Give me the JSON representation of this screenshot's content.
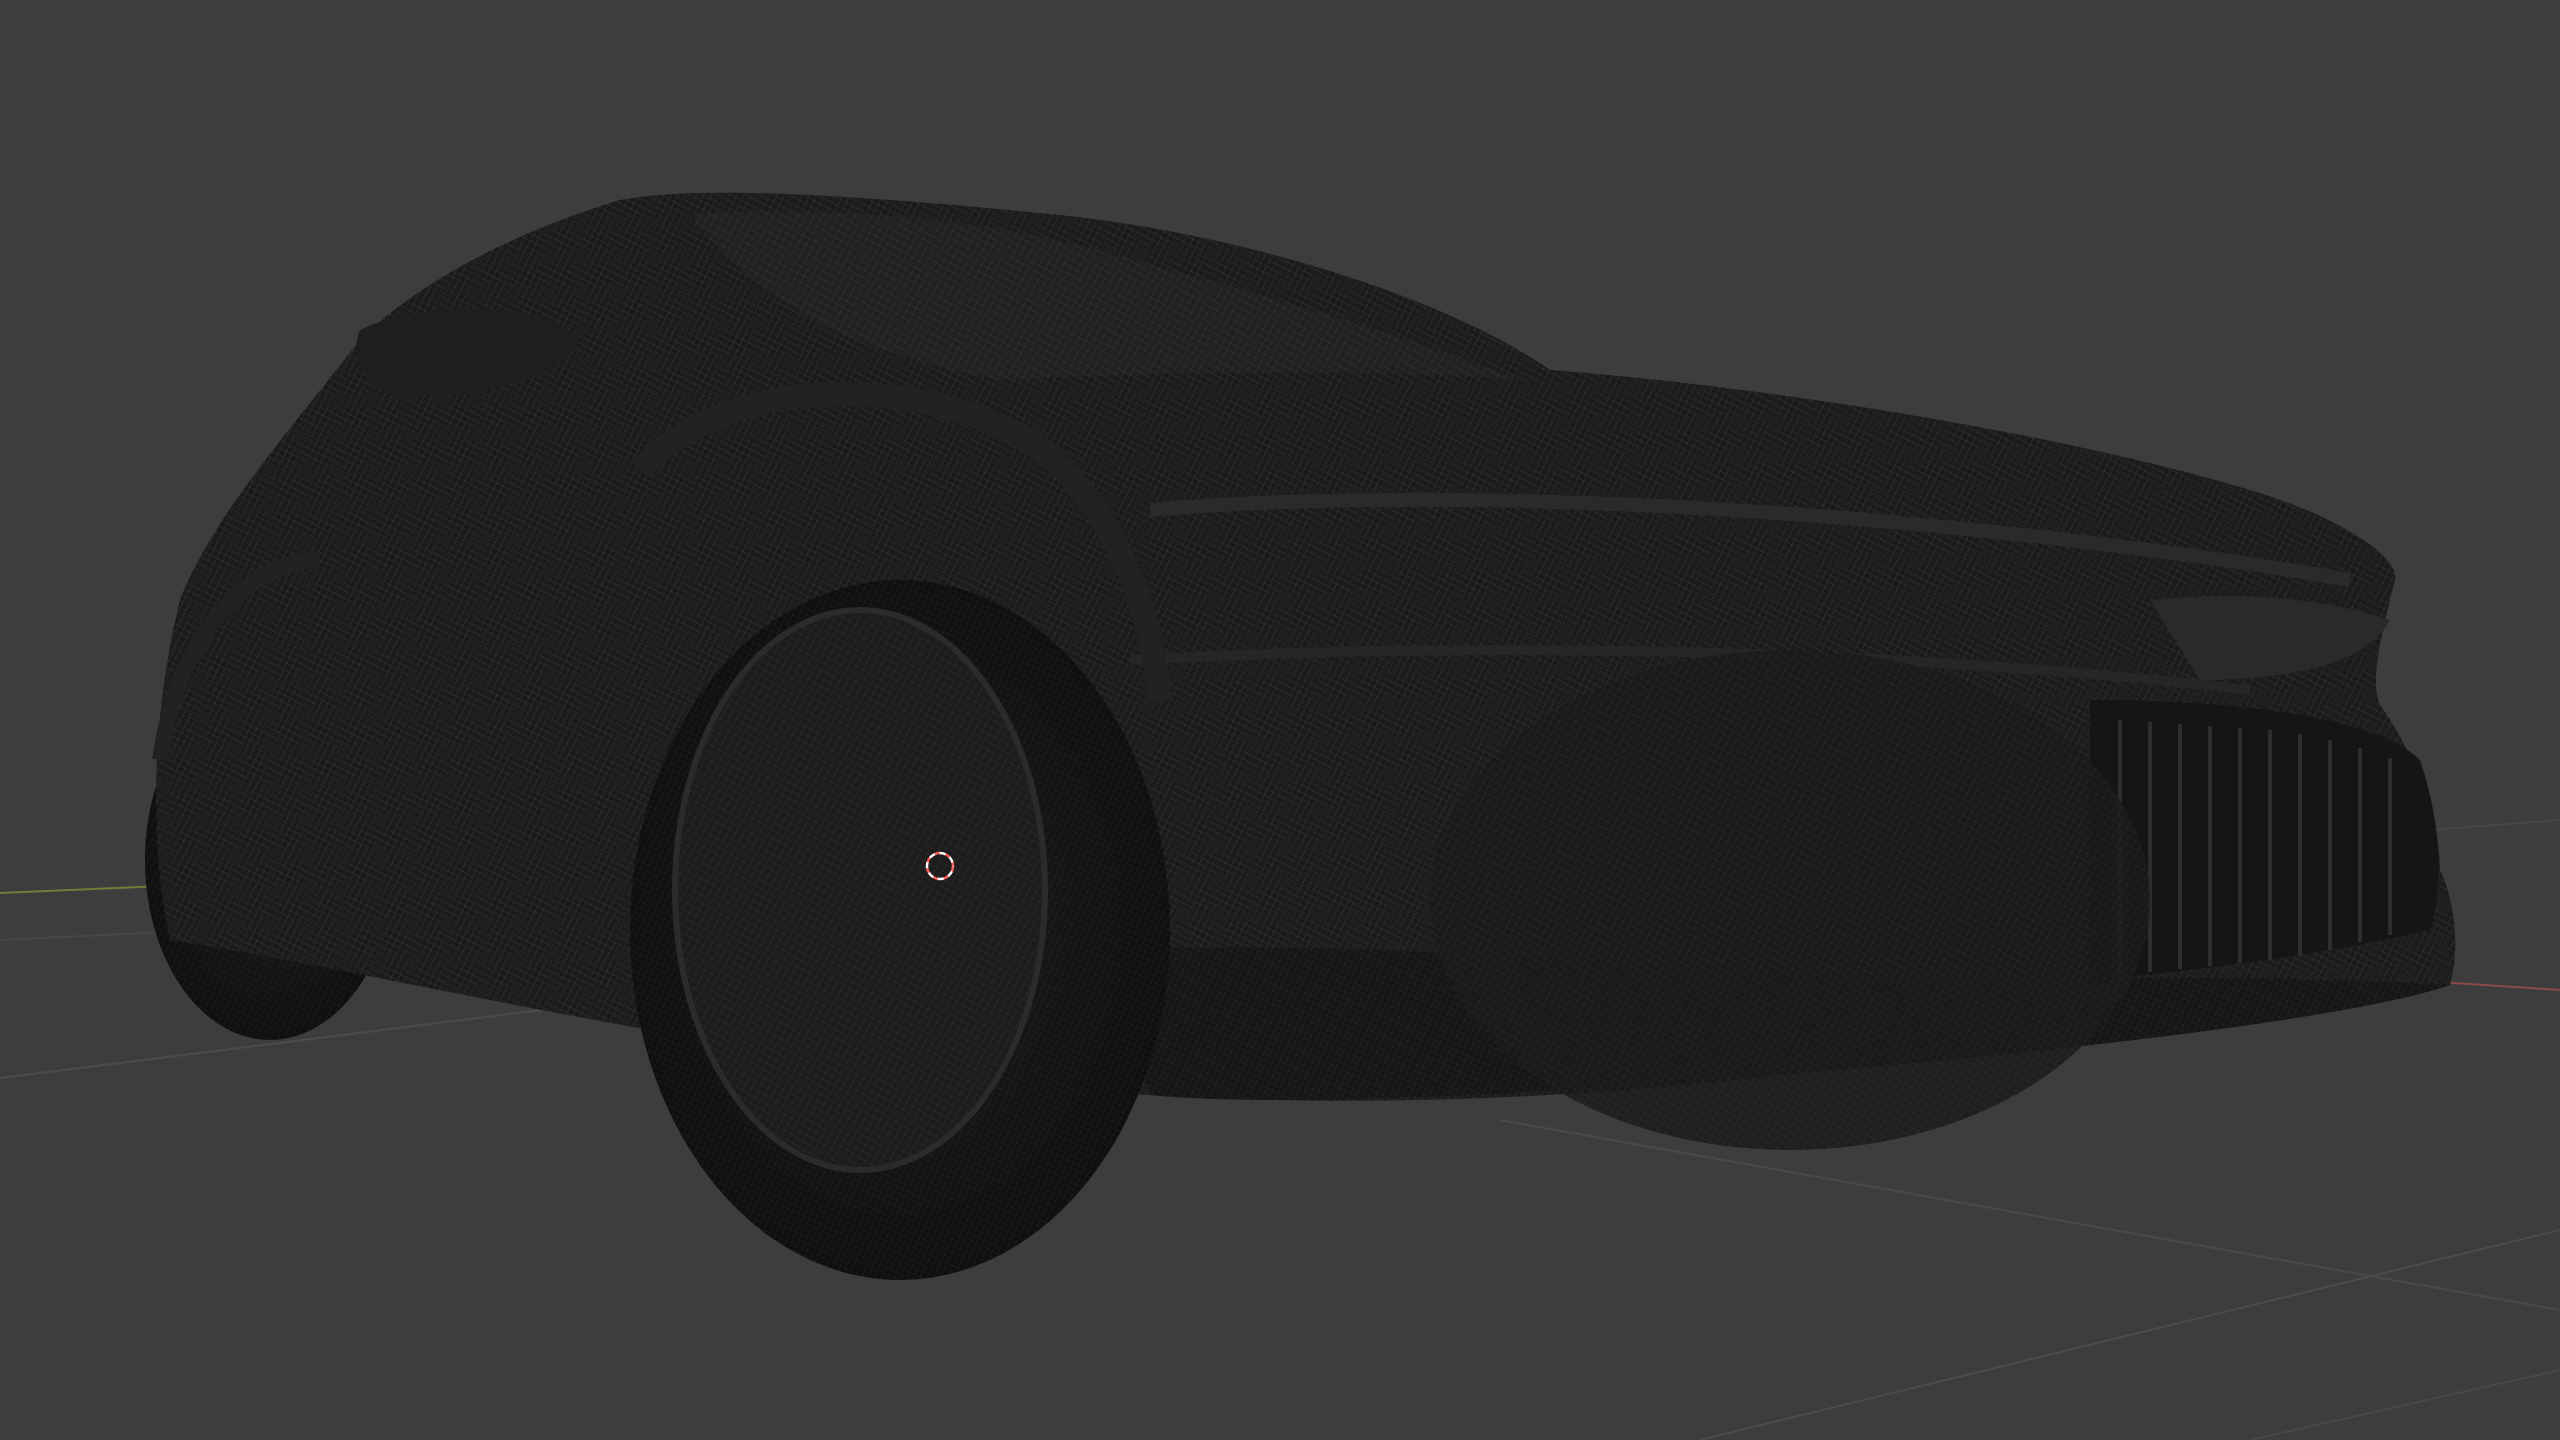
{
  "app": {
    "name": "3D viewport"
  },
  "viewport": {
    "background": "#3d3d3d",
    "shading": "wireframe-xray",
    "object": {
      "kind": "car-mesh",
      "mesh_color": "#141414",
      "wire_color": "#6a6a6a"
    },
    "axes": {
      "x_color": "#8a4a4a",
      "y_color": "#6f7f3a",
      "grid_color": "#4a4a4a"
    },
    "cursor": {
      "color": "#ff5c5c"
    }
  }
}
